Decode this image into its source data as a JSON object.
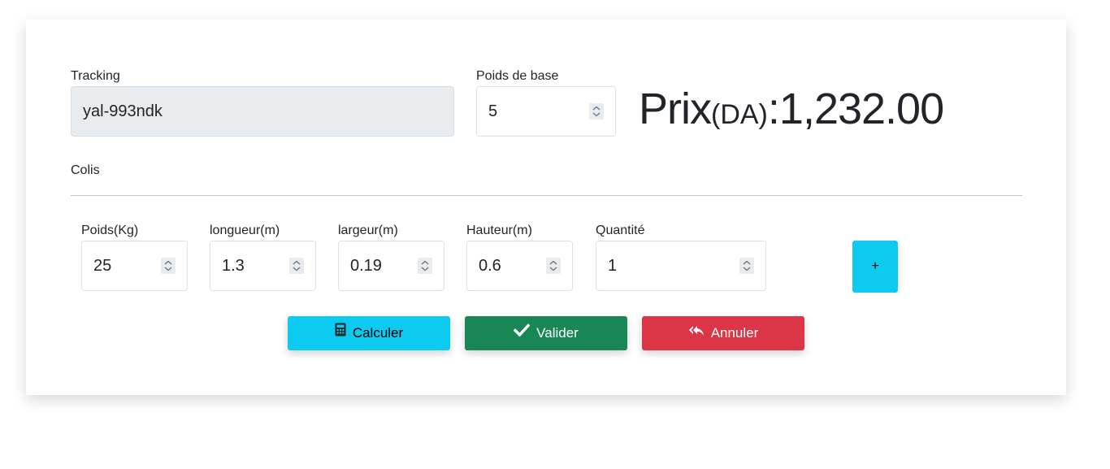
{
  "form": {
    "tracking_label": "Tracking",
    "tracking_value": "yal-993ndk",
    "base_weight_label": "Poids de base",
    "base_weight_value": "5",
    "price_prefix": "Prix",
    "price_unit": "(DA)",
    "price_colon": ":",
    "price_value": "1,232.00"
  },
  "colis": {
    "section_label": "Colis",
    "fields": [
      {
        "label": "Poids(Kg)",
        "value": "25"
      },
      {
        "label": "longueur(m)",
        "value": "1.3"
      },
      {
        "label": "largeur(m)",
        "value": "0.19"
      },
      {
        "label": "Hauteur(m)",
        "value": "0.6"
      },
      {
        "label": "Quantité",
        "value": "1"
      }
    ],
    "add_label": "+"
  },
  "actions": {
    "calculate_label": "Calculer",
    "validate_label": "Valider",
    "cancel_label": "Annuler"
  },
  "colors": {
    "info": "#0dcaf0",
    "success": "#198754",
    "danger": "#dc3545",
    "disabled_bg": "#e9ecef"
  },
  "icons": {
    "calculate": "calculator-icon",
    "validate": "check-icon",
    "cancel": "reply-all-icon",
    "spinner": "spinner-arrows-icon"
  }
}
